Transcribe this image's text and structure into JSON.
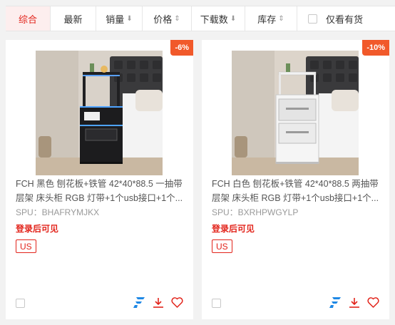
{
  "sort_bar": {
    "items": [
      {
        "label": "综合",
        "arrow": ""
      },
      {
        "label": "最新",
        "arrow": ""
      },
      {
        "label": "销量",
        "arrow": "⬇"
      },
      {
        "label": "价格",
        "arrow": "⇕"
      },
      {
        "label": "下载数",
        "arrow": "⬇"
      },
      {
        "label": "库存",
        "arrow": "⇕"
      }
    ],
    "in_stock_label": "仅看有货",
    "active_index": 0
  },
  "products": [
    {
      "discount": "-6%",
      "title": "FCH 黑色 刨花板+铁管 42*40*88.5 一抽带层架 床头柜 RGB 灯带+1个usb接口+1个...",
      "spu": "SPU：BHAFRYMJKX",
      "login_text": "登录后可见",
      "warehouse_tag": "US",
      "image_icon": "black-nightstand-image"
    },
    {
      "discount": "-10%",
      "title": "FCH 白色 刨花板+铁管 42*40*88.5 两抽带层架 床头柜 RGB 灯带+1个usb接口+1个...",
      "spu": "SPU：BXRHPWGYLP",
      "login_text": "登录后可见",
      "warehouse_tag": "US",
      "image_icon": "white-nightstand-image"
    }
  ],
  "colors": {
    "accent": "#e2231a",
    "badge": "#f1592a",
    "brand_icon": "#1e88e5",
    "download_icon": "#e2231a"
  },
  "icons": [
    "checkbox-icon",
    "brand-logo-icon",
    "download-icon",
    "heart-icon"
  ]
}
